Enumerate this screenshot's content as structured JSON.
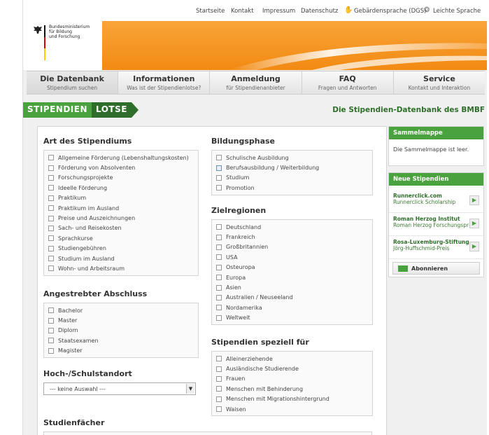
{
  "topnav": {
    "items": [
      "Startseite",
      "Kontakt",
      "Impressum",
      "Datenschutz",
      "Gebärdensprache (DGS)",
      "Leichte Sprache"
    ]
  },
  "logo": {
    "text": "Bundesministerium\nfür Bildung\nund Forschung"
  },
  "colors": {
    "green": "#4aa23e",
    "dark_green": "#2f6e2a",
    "orange": "#f7931e"
  },
  "mainnav": [
    {
      "title": "Die Datenbank",
      "sub": "Stipendium suchen"
    },
    {
      "title": "Informationen",
      "sub": "Was ist der Stipendienlotse?"
    },
    {
      "title": "Anmeldung",
      "sub": "für Stipendienanbieter"
    },
    {
      "title": "FAQ",
      "sub": "Fragen und Antworten"
    },
    {
      "title": "Service",
      "sub": "Kontakt und Interaktion"
    }
  ],
  "lotse": {
    "badge_a": "STIPENDIEN",
    "badge_b": "LOTSE",
    "title": "Die Stipendien-Datenbank des BMBF"
  },
  "art": {
    "title": "Art des Stipendiums",
    "items": [
      "Allgemeine Förderung (Lebenshaltungskosten)",
      "Förderung von Absolventen",
      "Forschungsprojekte",
      "Ideelle Förderung",
      "Praktikum",
      "Praktikum im Ausland",
      "Preise und Auszeichnungen",
      "Sach- und Reisekosten",
      "Sprachkurse",
      "Studiengebühren",
      "Studium im Ausland",
      "Wohn- und Arbeitsraum"
    ]
  },
  "abschluss": {
    "title": "Angestrebter Abschluss",
    "items": [
      "Bachelor",
      "Master",
      "Diplom",
      "Staatsexamen",
      "Magister"
    ]
  },
  "standort": {
    "title": "Hoch-/Schulstandort",
    "value": "--- keine Auswahl ---"
  },
  "studienfaecher": {
    "title": "Studienfächer"
  },
  "bildungsphase": {
    "title": "Bildungsphase",
    "items": [
      "Schulische Ausbildung",
      "Berufsausbildung / Weiterbildung",
      "Studium",
      "Promotion"
    ]
  },
  "zielregionen": {
    "title": "Zielregionen",
    "items": [
      "Deutschland",
      "Frankreich",
      "Großbritannien",
      "USA",
      "Osteuropa",
      "Europa",
      "Asien",
      "Australien / Neuseeland",
      "Nordamerika",
      "Weltweit"
    ]
  },
  "speziell": {
    "title": "Stipendien speziell für",
    "items": [
      "Alleinerziehende",
      "Ausländische Studierende",
      "Frauen",
      "Menschen mit Behinderung",
      "Menschen mit Migrationshintergrund",
      "Waisen"
    ]
  },
  "sammelmappe": {
    "title": "Sammelmappe",
    "text": "Die Sammelmappe ist leer."
  },
  "neue": {
    "title": "Neue Stipendien",
    "items": [
      {
        "org": "Runnerclick.com",
        "sch": "Runnerclick Scholarship"
      },
      {
        "org": "Roman Herzog Institut",
        "sch": "Roman Herzog Forschungspreis"
      },
      {
        "org": "Rosa-Luxemburg-Stiftung",
        "sch": "Jörg-Huffschmid-Preis"
      }
    ],
    "subscribe": "Abonnieren"
  }
}
